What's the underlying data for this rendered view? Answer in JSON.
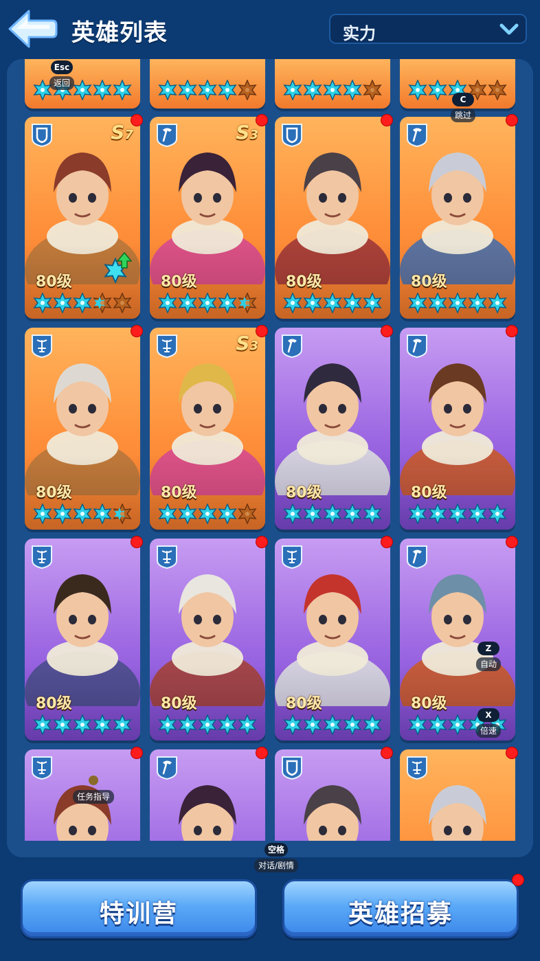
{
  "header": {
    "title": "英雄列表",
    "sort_label": "实力"
  },
  "colors": {
    "background": "#0c3a73",
    "panel": "#1b4f8c",
    "orange_card": "#ff8f3a",
    "purple_card": "#9c67e2",
    "star": "#2ed0e6",
    "star_empty": "#b8621f",
    "badge_dot": "#ff1c1c",
    "button": "#5aa9f7"
  },
  "top_row_partial": [
    {
      "stars": 5,
      "empty": 0
    },
    {
      "stars": 4,
      "empty": 1
    },
    {
      "stars": 4,
      "empty": 1
    },
    {
      "stars": 3,
      "empty": 2
    }
  ],
  "heroes": [
    {
      "level": "80级",
      "rarity": "orange",
      "class_icon": "shield-icon",
      "s_rank": "S",
      "s_num": "7",
      "stars": 3,
      "half": 1,
      "empty": 1,
      "upgrade": true,
      "dot": true
    },
    {
      "level": "80级",
      "rarity": "orange",
      "class_icon": "pickaxe-icon",
      "s_rank": "S",
      "s_num": "3",
      "stars": 4,
      "half": 1,
      "empty": 0,
      "upgrade": false,
      "dot": true
    },
    {
      "level": "80级",
      "rarity": "orange",
      "class_icon": "shield-icon",
      "s_rank": "",
      "s_num": "",
      "stars": 5,
      "half": 0,
      "empty": 0,
      "upgrade": false,
      "dot": true
    },
    {
      "level": "80级",
      "rarity": "orange",
      "class_icon": "pickaxe-icon",
      "s_rank": "",
      "s_num": "",
      "stars": 5,
      "half": 0,
      "empty": 0,
      "upgrade": false,
      "dot": true
    },
    {
      "level": "80级",
      "rarity": "orange",
      "class_icon": "crossbow-icon",
      "s_rank": "",
      "s_num": "",
      "stars": 4,
      "half": 1,
      "empty": 0,
      "upgrade": false,
      "dot": true
    },
    {
      "level": "80级",
      "rarity": "orange",
      "class_icon": "crossbow-icon",
      "s_rank": "S",
      "s_num": "3",
      "stars": 4,
      "half": 0,
      "empty": 1,
      "upgrade": false,
      "dot": true
    },
    {
      "level": "80级",
      "rarity": "purple",
      "class_icon": "pickaxe-icon",
      "s_rank": "",
      "s_num": "",
      "stars": 5,
      "half": 0,
      "empty": 0,
      "upgrade": false,
      "dot": true
    },
    {
      "level": "80级",
      "rarity": "purple",
      "class_icon": "pickaxe-icon",
      "s_rank": "",
      "s_num": "",
      "stars": 5,
      "half": 0,
      "empty": 0,
      "upgrade": false,
      "dot": true
    },
    {
      "level": "80级",
      "rarity": "purple",
      "class_icon": "crossbow-icon",
      "s_rank": "",
      "s_num": "",
      "stars": 5,
      "half": 0,
      "empty": 0,
      "upgrade": false,
      "dot": true
    },
    {
      "level": "80级",
      "rarity": "purple",
      "class_icon": "crossbow-icon",
      "s_rank": "",
      "s_num": "",
      "stars": 5,
      "half": 0,
      "empty": 0,
      "upgrade": false,
      "dot": true
    },
    {
      "level": "80级",
      "rarity": "purple",
      "class_icon": "crossbow-icon",
      "s_rank": "",
      "s_num": "",
      "stars": 5,
      "half": 0,
      "empty": 0,
      "upgrade": false,
      "dot": true
    },
    {
      "level": "80级",
      "rarity": "purple",
      "class_icon": "pickaxe-icon",
      "s_rank": "",
      "s_num": "",
      "stars": 5,
      "half": 0,
      "empty": 0,
      "upgrade": false,
      "dot": true
    },
    {
      "level": "",
      "rarity": "purple",
      "class_icon": "crossbow-icon",
      "s_rank": "",
      "s_num": "",
      "stars": 0,
      "half": 0,
      "empty": 0,
      "upgrade": false,
      "dot": true
    },
    {
      "level": "",
      "rarity": "purple",
      "class_icon": "pickaxe-icon",
      "s_rank": "",
      "s_num": "",
      "stars": 0,
      "half": 0,
      "empty": 0,
      "upgrade": false,
      "dot": true
    },
    {
      "level": "",
      "rarity": "purple",
      "class_icon": "shield-icon",
      "s_rank": "",
      "s_num": "",
      "stars": 0,
      "half": 0,
      "empty": 0,
      "upgrade": false,
      "dot": true
    },
    {
      "level": "",
      "rarity": "orange",
      "class_icon": "crossbow-icon",
      "s_rank": "",
      "s_num": "",
      "stars": 0,
      "half": 0,
      "empty": 0,
      "upgrade": false,
      "dot": true
    }
  ],
  "buttons": {
    "training": "特训营",
    "recruit": "英雄招募"
  },
  "hints": {
    "esc_key": "Esc",
    "esc_desc": "返回",
    "c_key": "C",
    "c_desc": "跳过",
    "z_key": "Z",
    "z_desc": "自动",
    "x_key": "X",
    "x_desc": "倍速",
    "task_desc": "任务指导",
    "space_key": "空格",
    "space_desc": "对话/剧情"
  }
}
